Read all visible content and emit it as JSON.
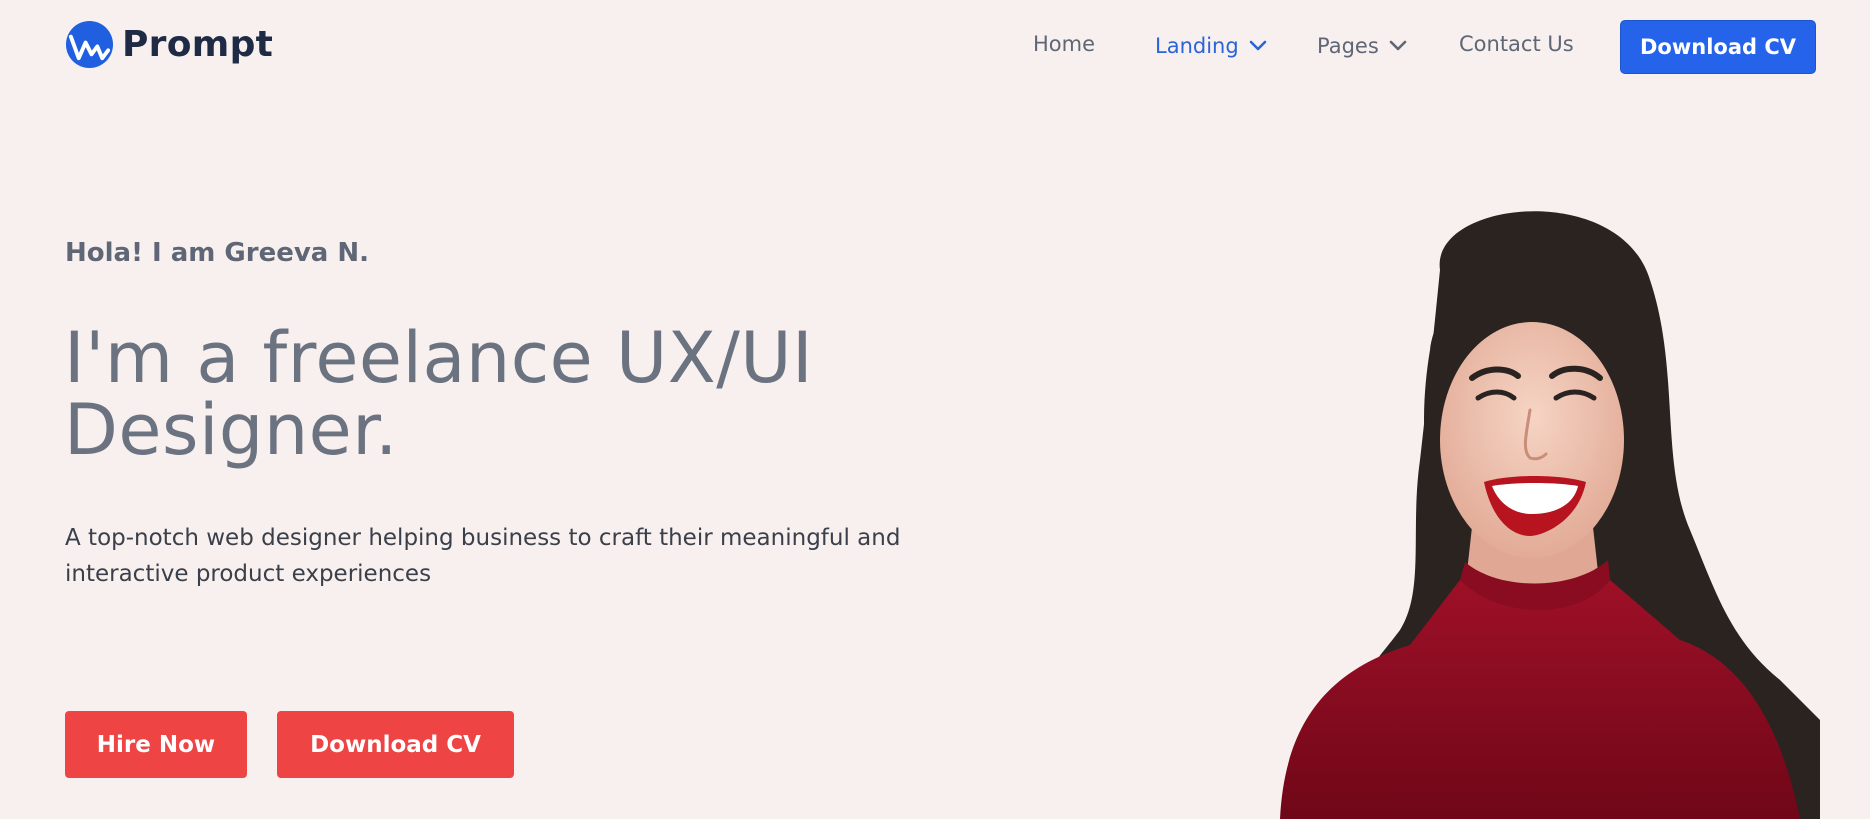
{
  "brand": {
    "name": "Prompt",
    "icon": "waveform-logo-icon",
    "color": "#1f5fe0"
  },
  "nav": {
    "items": [
      {
        "label": "Home",
        "dropdown": false,
        "active": false
      },
      {
        "label": "Landing",
        "dropdown": true,
        "active": true
      },
      {
        "label": "Pages",
        "dropdown": true,
        "active": false
      },
      {
        "label": "Contact Us",
        "dropdown": false,
        "active": false
      }
    ],
    "cta_label": "Download CV",
    "chevron_icon": "chevron-down-icon"
  },
  "hero": {
    "greeting": "Hola! I am Greeva N.",
    "headline_line1": "I'm a freelance UX/UI",
    "headline_line2": "Designer.",
    "description": "A top-notch web designer helping business to craft their meaningful and interactive product experiences",
    "buttons": {
      "hire": "Hire Now",
      "download": "Download CV"
    },
    "image": "smiling-woman-portrait"
  },
  "colors": {
    "background": "#f8f0ef",
    "accent_blue": "#2563eb",
    "accent_red": "#ef4444",
    "text_dark": "#1f2a44",
    "text_muted": "#6b7280"
  }
}
